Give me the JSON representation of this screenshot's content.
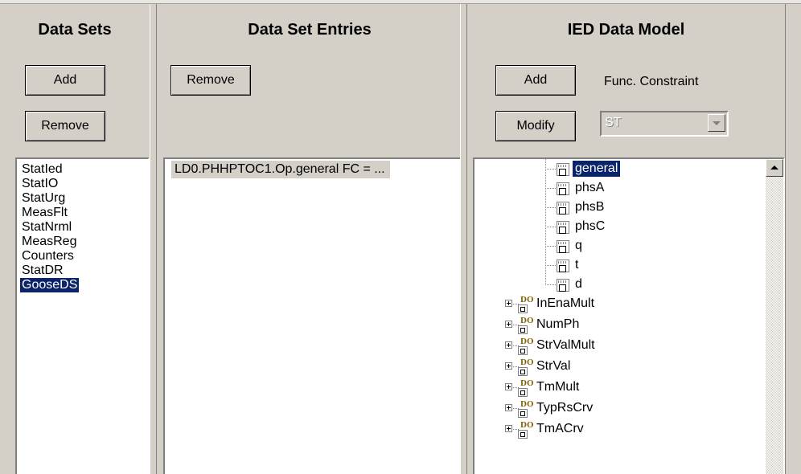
{
  "data_sets": {
    "header": "Data Sets",
    "add_label": "Add",
    "remove_label": "Remove",
    "items": [
      "StatIed",
      "StatIO",
      "StatUrg",
      "MeasFlt",
      "StatNrml",
      "MeasReg",
      "Counters",
      "StatDR",
      "GooseDS"
    ],
    "selected": "GooseDS"
  },
  "entries": {
    "header": "Data Set Entries",
    "remove_label": "Remove",
    "items": [
      "LD0.PHHPTOC1.Op.general FC = ..."
    ]
  },
  "model": {
    "header": "IED Data Model",
    "add_label": "Add",
    "modify_label": "Modify",
    "fc_label": "Func. Constraint",
    "fc_value": "ST",
    "leaves": [
      "general",
      "phsA",
      "phsB",
      "phsC",
      "q",
      "t",
      "d"
    ],
    "selected_leaf": "general",
    "do_nodes": [
      "InEnaMult",
      "NumPh",
      "StrValMult",
      "StrVal",
      "TmMult",
      "TypRsCrv",
      "TmACrv"
    ],
    "leaf_icon": "data-attribute-icon",
    "do_icon": "data-object-icon"
  }
}
